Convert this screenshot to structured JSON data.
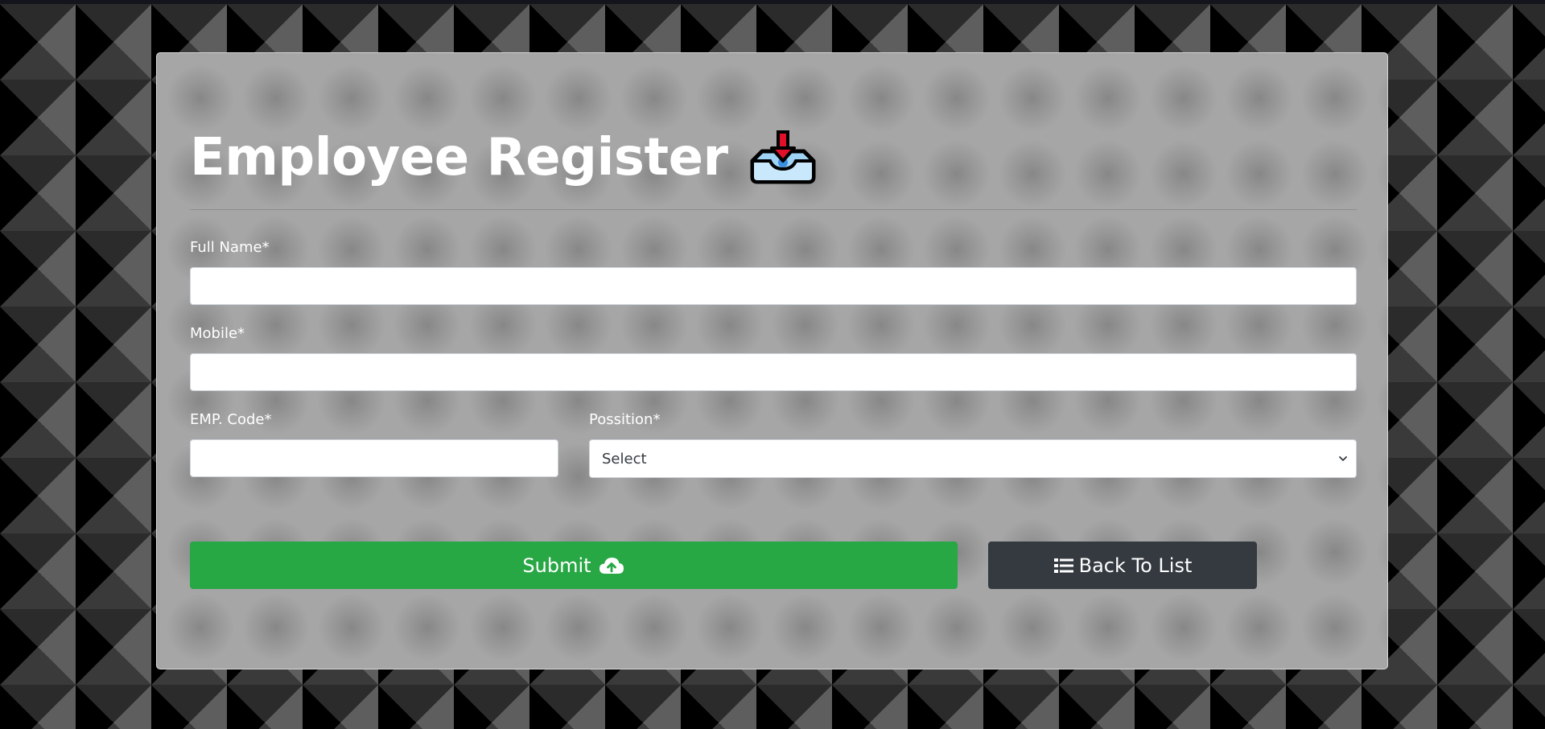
{
  "form": {
    "title": "Employee Register",
    "title_icon": "inbox-tray-icon",
    "fields": {
      "full_name": {
        "label": "Full Name*",
        "value": "",
        "placeholder": ""
      },
      "mobile": {
        "label": "Mobile*",
        "value": "",
        "placeholder": ""
      },
      "emp_code": {
        "label": "EMP. Code*",
        "value": "",
        "placeholder": ""
      },
      "position": {
        "label": "Possition*",
        "selected": "Select"
      }
    },
    "buttons": {
      "submit_label": "Submit",
      "submit_icon": "cloud-upload-icon",
      "back_label": "Back To List",
      "back_icon": "list-icon"
    }
  },
  "colors": {
    "submit": "#28a745",
    "back": "#343a40",
    "title": "#ffffff"
  }
}
